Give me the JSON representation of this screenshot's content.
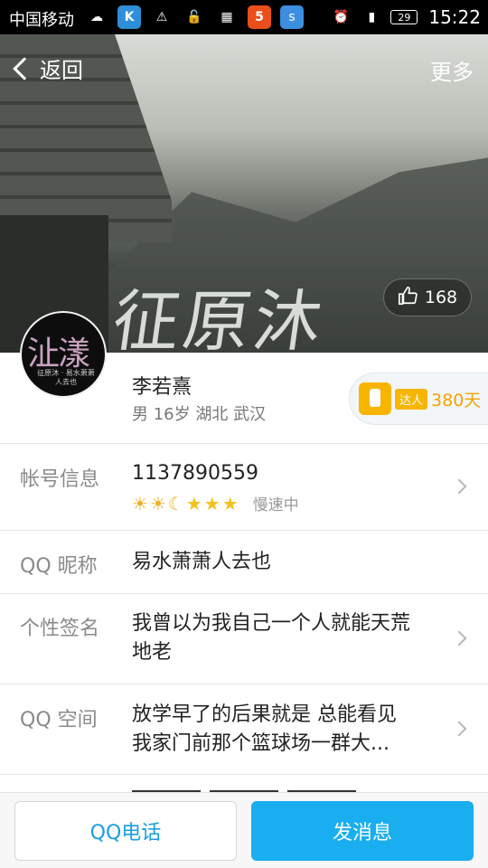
{
  "status_bar": {
    "carrier": "中国移动",
    "battery": "29",
    "time": "15:22",
    "icons": [
      "cloud-icon",
      "k-app-icon",
      "warning-icon",
      "vpn-icon",
      "grid-app-icon",
      "sohu-app-icon",
      "s-app-icon",
      "alarm-icon",
      "signal-icon",
      "battery-icon"
    ]
  },
  "nav": {
    "back_label": "返回",
    "more_label": "更多"
  },
  "cover": {
    "calligraphy": "征原沐",
    "likes": "168"
  },
  "avatar": {
    "main": "沚漾",
    "sub": "征原沐 · 易水萧萧人去也"
  },
  "profile": {
    "name": "李若熹",
    "meta": "男 16岁 湖北 武汉",
    "badge_tag": "达人",
    "badge_days": "380天"
  },
  "rows": {
    "account": {
      "label": "帐号信息",
      "value": "1137890559",
      "speed": "慢速中"
    },
    "nickname": {
      "label": "QQ 昵称",
      "value": "易水萧萧人去也"
    },
    "signature": {
      "label": "个性签名",
      "value_line1": "我曾以为我自己一个人就能天荒",
      "value_line2": "地老"
    },
    "qzone": {
      "label": "QQ 空间",
      "value_line1": "放学早了的后果就是 总能看见",
      "value_line2": "我家门前那个篮球场一群大..."
    }
  },
  "level_icons": [
    "sun-icon",
    "sun-icon",
    "moon-icon",
    "star-icon",
    "star-icon",
    "star-icon"
  ],
  "colors": {
    "accent": "#19aef0",
    "badge": "#f7b500"
  },
  "bottom": {
    "call_label": "QQ电话",
    "message_label": "发消息"
  }
}
